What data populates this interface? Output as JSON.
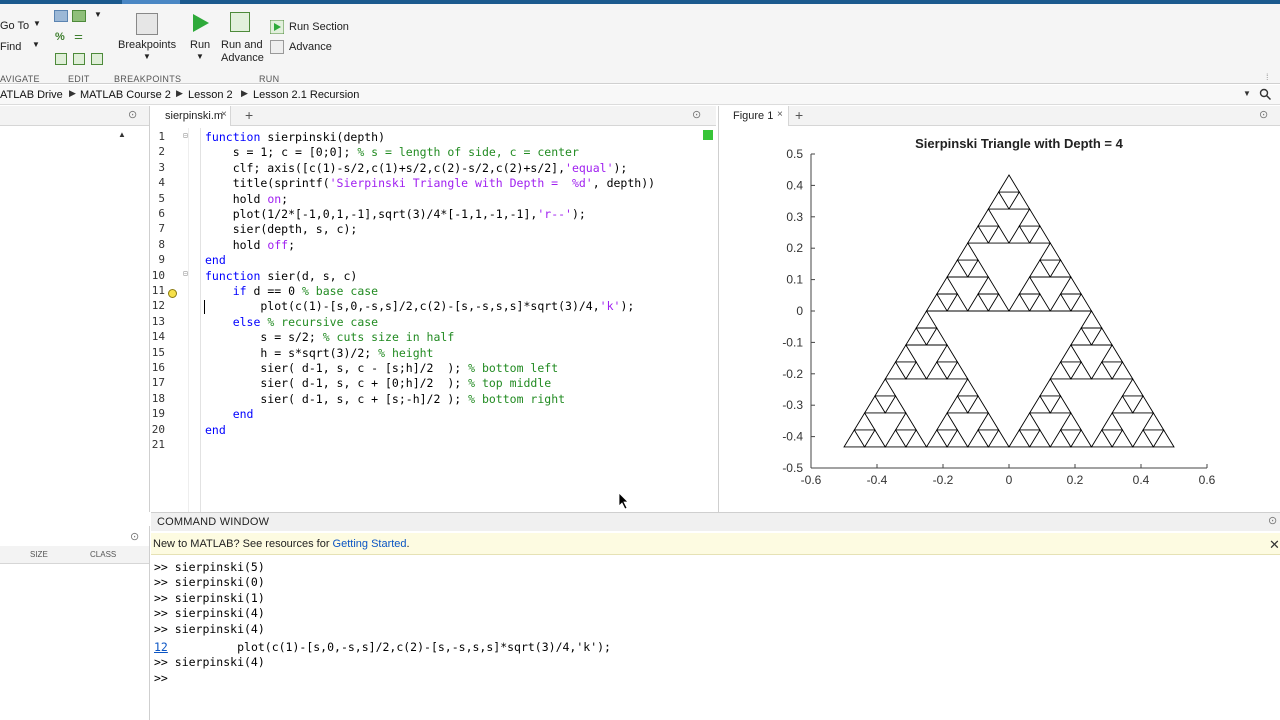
{
  "ribbon": {
    "goto_label": "Go To",
    "find_label": "Find",
    "navigate_group": "AVIGATE",
    "edit_group": "EDIT",
    "breakpoints_label": "Breakpoints",
    "breakpoints_group": "BREAKPOINTS",
    "run_label": "Run",
    "run_and_advance_line1": "Run and",
    "run_and_advance_line2": "Advance",
    "run_section_label": "Run Section",
    "advance_label": "Advance",
    "run_group": "RUN"
  },
  "breadcrumb": [
    "ATLAB Drive",
    "MATLAB Course 2",
    "Lesson 2",
    "Lesson 2.1 Recursion"
  ],
  "workspace": {
    "col_size": "SIZE",
    "col_class": "CLASS"
  },
  "editor": {
    "tab_label": "sierpinski.m",
    "add_tab": "+",
    "lines": [
      {
        "n": "1",
        "segs": [
          {
            "c": "kw",
            "t": "function"
          },
          {
            "c": "",
            "t": " sierpinski(depth)"
          }
        ]
      },
      {
        "n": "2",
        "segs": [
          {
            "c": "",
            "t": "    s = 1; c = [0;0]; "
          },
          {
            "c": "cm",
            "t": "% s = length of side, c = center"
          }
        ]
      },
      {
        "n": "3",
        "segs": [
          {
            "c": "",
            "t": "    clf; axis([c(1)-s/2,c(1)+s/2,c(2)-s/2,c(2)+s/2],"
          },
          {
            "c": "st",
            "t": "'equal'"
          },
          {
            "c": "",
            "t": ");"
          }
        ]
      },
      {
        "n": "4",
        "segs": [
          {
            "c": "",
            "t": "    title(sprintf("
          },
          {
            "c": "st",
            "t": "'Sierpinski Triangle with Depth =  %d'"
          },
          {
            "c": "",
            "t": ", depth))"
          }
        ]
      },
      {
        "n": "5",
        "segs": [
          {
            "c": "",
            "t": "    hold "
          },
          {
            "c": "st",
            "t": "on"
          },
          {
            "c": "",
            "t": ";"
          }
        ]
      },
      {
        "n": "6",
        "segs": [
          {
            "c": "",
            "t": "    plot(1/2*[-1,0,1,-1],sqrt(3)/4*[-1,1,-1,-1],"
          },
          {
            "c": "st",
            "t": "'r--'"
          },
          {
            "c": "",
            "t": ");"
          }
        ]
      },
      {
        "n": "7",
        "segs": [
          {
            "c": "",
            "t": "    sier(depth, s, c);"
          }
        ]
      },
      {
        "n": "8",
        "segs": [
          {
            "c": "",
            "t": "    hold "
          },
          {
            "c": "st",
            "t": "off"
          },
          {
            "c": "",
            "t": ";"
          }
        ]
      },
      {
        "n": "9",
        "segs": [
          {
            "c": "kw",
            "t": "end"
          }
        ]
      },
      {
        "n": "10",
        "segs": [
          {
            "c": "kw",
            "t": "function"
          },
          {
            "c": "",
            "t": " sier(d, s, c)"
          }
        ]
      },
      {
        "n": "11",
        "segs": [
          {
            "c": "kw",
            "t": "    if"
          },
          {
            "c": "",
            "t": " d == 0 "
          },
          {
            "c": "cm",
            "t": "% base case"
          }
        ]
      },
      {
        "n": "12",
        "segs": [
          {
            "c": "",
            "t": "        plot(c(1)-[s,0,-s,s]/2,c(2)-[s,-s,s,s]*sqrt(3)/4,"
          },
          {
            "c": "st",
            "t": "'k'"
          },
          {
            "c": "",
            "t": ");"
          }
        ]
      },
      {
        "n": "13",
        "segs": [
          {
            "c": "kw",
            "t": "    else"
          },
          {
            "c": "",
            "t": " "
          },
          {
            "c": "cm",
            "t": "% recursive case"
          }
        ]
      },
      {
        "n": "14",
        "segs": [
          {
            "c": "",
            "t": "        s = s/2; "
          },
          {
            "c": "cm",
            "t": "% cuts size in half"
          }
        ]
      },
      {
        "n": "15",
        "segs": [
          {
            "c": "",
            "t": "        h = s*sqrt(3)/2; "
          },
          {
            "c": "cm",
            "t": "% height"
          }
        ]
      },
      {
        "n": "16",
        "segs": [
          {
            "c": "",
            "t": "        sier( d-1, s, c - [s;h]/2  ); "
          },
          {
            "c": "cm",
            "t": "% bottom left"
          }
        ]
      },
      {
        "n": "17",
        "segs": [
          {
            "c": "",
            "t": "        sier( d-1, s, c + [0;h]/2  ); "
          },
          {
            "c": "cm",
            "t": "% top middle"
          }
        ]
      },
      {
        "n": "18",
        "segs": [
          {
            "c": "",
            "t": "        sier( d-1, s, c + [s;-h]/2 ); "
          },
          {
            "c": "cm",
            "t": "% bottom right"
          }
        ]
      },
      {
        "n": "19",
        "segs": [
          {
            "c": "kw",
            "t": "    end"
          }
        ]
      },
      {
        "n": "20",
        "segs": [
          {
            "c": "kw",
            "t": "end"
          }
        ]
      },
      {
        "n": "21",
        "segs": []
      }
    ]
  },
  "figure": {
    "tab_label": "Figure 1",
    "add_tab": "+"
  },
  "chart_data": {
    "type": "line",
    "title": "Sierpinski Triangle with Depth =  4",
    "depth": 4,
    "xlim": [
      -0.6,
      0.6
    ],
    "ylim": [
      -0.5,
      0.5
    ],
    "xticks": [
      "-0.6",
      "-0.4",
      "-0.2",
      "0",
      "0.2",
      "0.4",
      "0.6"
    ],
    "yticks": [
      "0.5",
      "0.4",
      "0.3",
      "0.2",
      "0.1",
      "0",
      "-0.1",
      "-0.2",
      "-0.3",
      "-0.4",
      "-0.5"
    ],
    "triangle": {
      "base_y": -0.433,
      "apex_y": 0.433,
      "half_width": 0.5
    },
    "line_color": "#000000",
    "grid": false
  },
  "command_window": {
    "title": "COMMAND WINDOW",
    "notice_text": "New to MATLAB? See resources for ",
    "notice_link": "Getting Started",
    "notice_end": ".",
    "history": [
      ">> sierpinski(5)",
      ">> sierpinski(0)",
      ">> sierpinski(1)",
      ">> sierpinski(4)",
      ">> sierpinski(4)"
    ],
    "debug_line_no": "12",
    "debug_line_code": "        plot(c(1)-[s,0,-s,s]/2,c(2)-[s,-s,s,s]*sqrt(3)/4,'k');",
    "after": [
      ">> sierpinski(4)",
      ">> "
    ]
  }
}
